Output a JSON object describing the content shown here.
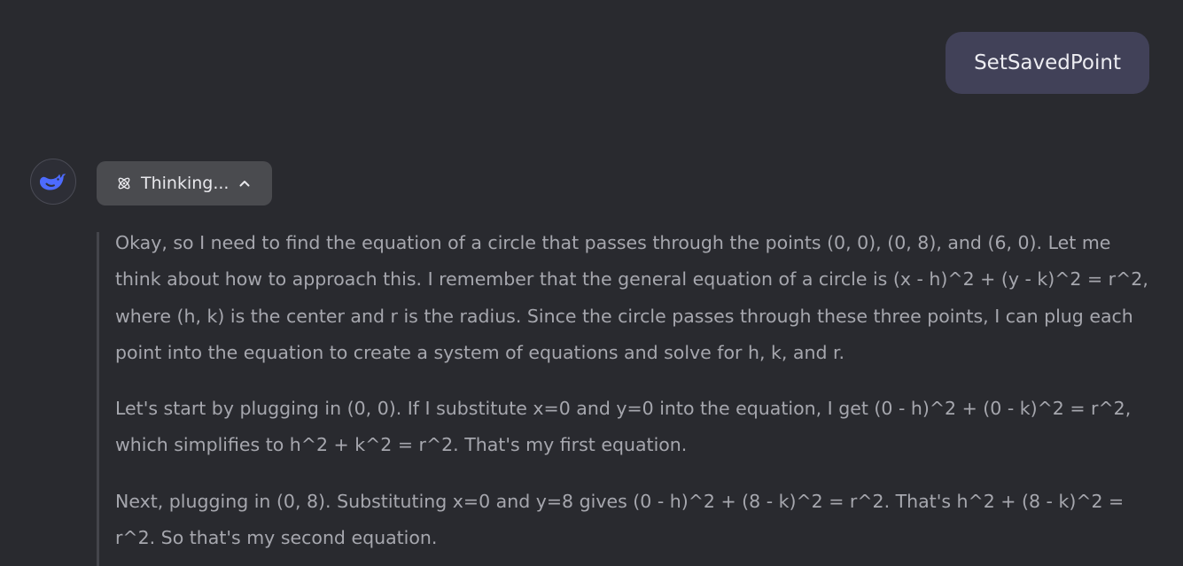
{
  "user_message": {
    "text": "SetSavedPoint"
  },
  "assistant": {
    "avatar_icon": "deepseek-whale-icon",
    "thinking_toggle": {
      "icon": "atom-icon",
      "label": "Thinking...",
      "chevron_icon": "chevron-up-icon",
      "expanded": true
    },
    "thinking_paragraphs": [
      "Okay, so I need to find the equation of a circle that passes through the points (0, 0), (0, 8), and (6, 0). Let me think about how to approach this. I remember that the general equation of a circle is (x - h)^2 + (y - k)^2 = r^2, where (h, k) is the center and r is the radius. Since the circle passes through these three points, I can plug each point into the equation to create a system of equations and solve for h, k, and r.",
      "Let's start by plugging in (0, 0). If I substitute x=0 and y=0 into the equation, I get (0 - h)^2 + (0 - k)^2 = r^2, which simplifies to h^2 + k^2 = r^2. That's my first equation.",
      "Next, plugging in (0, 8). Substituting x=0 and y=8 gives (0 - h)^2 + (8 - k)^2 = r^2. That's h^2 + (8 - k)^2 = r^2. So that's my second equation."
    ]
  },
  "colors": {
    "background": "#292a2f",
    "user_bubble": "#414158",
    "thinking_pill": "#4a4b4f",
    "thinking_text": "#a6a7ae",
    "accent": "#4d6bfe"
  }
}
